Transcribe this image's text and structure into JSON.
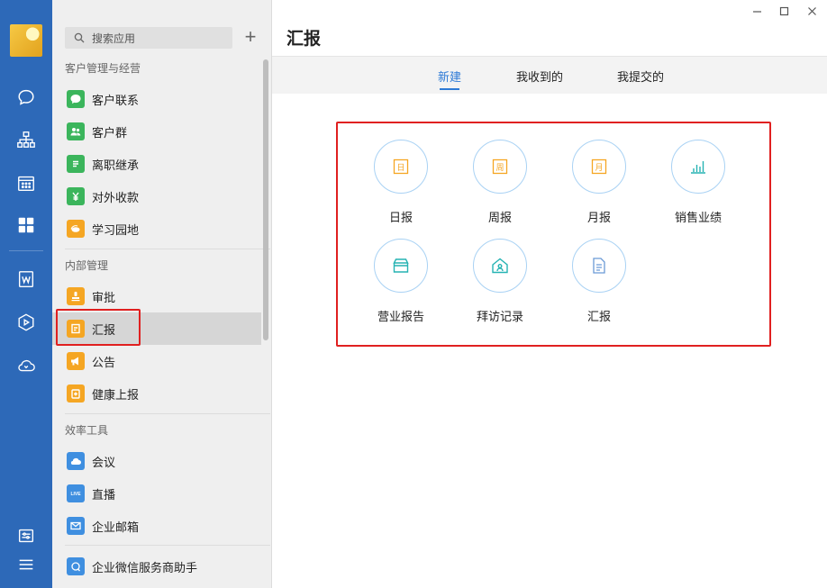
{
  "rail": {
    "icons": [
      "chat-icon",
      "org-chart-icon",
      "calendar-icon",
      "apps-grid-icon",
      "doc-w-icon",
      "cube-icon",
      "cloud-phone-icon",
      "settings-icon",
      "menu-icon"
    ]
  },
  "sidebar": {
    "search_placeholder": "搜索应用",
    "add_symbol": "+",
    "sections": {
      "customer": "客户管理与经营",
      "internal": "内部管理",
      "efficiency": "效率工具"
    },
    "items": [
      {
        "label": "客户联系",
        "icon": "chat-bubble-icon",
        "color": "#3bb55c"
      },
      {
        "label": "客户群",
        "icon": "group-icon",
        "color": "#3bb55c"
      },
      {
        "label": "离职继承",
        "icon": "doc-list-icon",
        "color": "#3bb55c"
      },
      {
        "label": "对外收款",
        "icon": "yen-icon",
        "color": "#3bb55c"
      },
      {
        "label": "学习园地",
        "icon": "planet-icon",
        "color": "#f5a623"
      },
      {
        "label": "审批",
        "icon": "stamp-icon",
        "color": "#f5a623"
      },
      {
        "label": "汇报",
        "icon": "report-icon",
        "color": "#f5a623"
      },
      {
        "label": "公告",
        "icon": "megaphone-icon",
        "color": "#f5a623"
      },
      {
        "label": "健康上报",
        "icon": "health-icon",
        "color": "#f5a623"
      },
      {
        "label": "会议",
        "icon": "cloud-icon",
        "color": "#3f8fe0"
      },
      {
        "label": "直播",
        "icon": "live-icon",
        "color": "#3f8fe0"
      },
      {
        "label": "企业邮箱",
        "icon": "mail-icon",
        "color": "#3f8fe0"
      },
      {
        "label": "企业微信服务商助手",
        "icon": "service-chat-icon",
        "color": "#3f8fe0"
      }
    ]
  },
  "main": {
    "title": "汇报",
    "tabs": [
      {
        "label": "新建",
        "active": true
      },
      {
        "label": "我收到的",
        "active": false
      },
      {
        "label": "我提交的",
        "active": false
      }
    ],
    "tiles": [
      {
        "label": "日报",
        "icon": "day-report-icon",
        "color": "#f5a623"
      },
      {
        "label": "周报",
        "icon": "week-report-icon",
        "color": "#f5a623"
      },
      {
        "label": "月报",
        "icon": "month-report-icon",
        "color": "#f5a623"
      },
      {
        "label": "销售业绩",
        "icon": "bar-chart-icon",
        "color": "#26b3b3"
      },
      {
        "label": "营业报告",
        "icon": "store-icon",
        "color": "#26b3b3"
      },
      {
        "label": "拜访记录",
        "icon": "house-person-icon",
        "color": "#26b3b3"
      },
      {
        "label": "汇报",
        "icon": "document-icon",
        "color": "#6b9ad6"
      }
    ],
    "tile_glyphs": {
      "day": "日",
      "week": "周",
      "month": "月"
    }
  },
  "colors": {
    "accent": "#2d7ad6",
    "rail": "#2d69b8",
    "highlight": "#e02020"
  }
}
